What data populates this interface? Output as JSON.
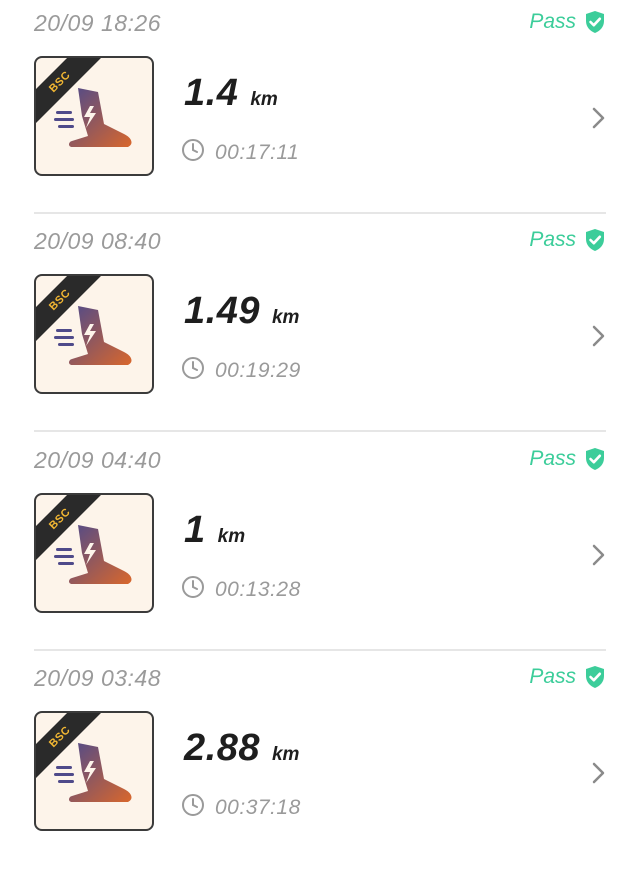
{
  "colors": {
    "pass_green": "#3ccd9a",
    "muted_gray": "#9a9a9a",
    "badge_gold": "#f2b733",
    "shoe_gradient_start": "#4f4a8a",
    "shoe_gradient_end": "#d9672c"
  },
  "records": [
    {
      "date": "20/09 18:26",
      "status": "Pass",
      "status_icon": "shield-check-icon",
      "badge": "BSC",
      "distance": "1.4",
      "unit": "km",
      "duration": "00:17:11"
    },
    {
      "date": "20/09 08:40",
      "status": "Pass",
      "status_icon": "shield-check-icon",
      "badge": "BSC",
      "distance": "1.49",
      "unit": "km",
      "duration": "00:19:29"
    },
    {
      "date": "20/09 04:40",
      "status": "Pass",
      "status_icon": "shield-check-icon",
      "badge": "BSC",
      "distance": "1",
      "unit": "km",
      "duration": "00:13:28"
    },
    {
      "date": "20/09 03:48",
      "status": "Pass",
      "status_icon": "shield-check-icon",
      "badge": "BSC",
      "distance": "2.88",
      "unit": "km",
      "duration": "00:37:18"
    }
  ]
}
